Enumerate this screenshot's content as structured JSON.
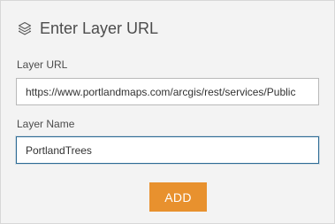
{
  "dialog": {
    "title": "Enter Layer URL",
    "title_icon": "layers-icon"
  },
  "form": {
    "layer_url_label": "Layer URL",
    "layer_url_value": "https://www.portlandmaps.com/arcgis/rest/services/Public",
    "layer_name_label": "Layer Name",
    "layer_name_value": "PortlandTrees"
  },
  "actions": {
    "add_label": "ADD"
  },
  "colors": {
    "accent": "#e8912e",
    "focus_border": "#2d6b95",
    "panel_background": "#f3f3f3"
  }
}
